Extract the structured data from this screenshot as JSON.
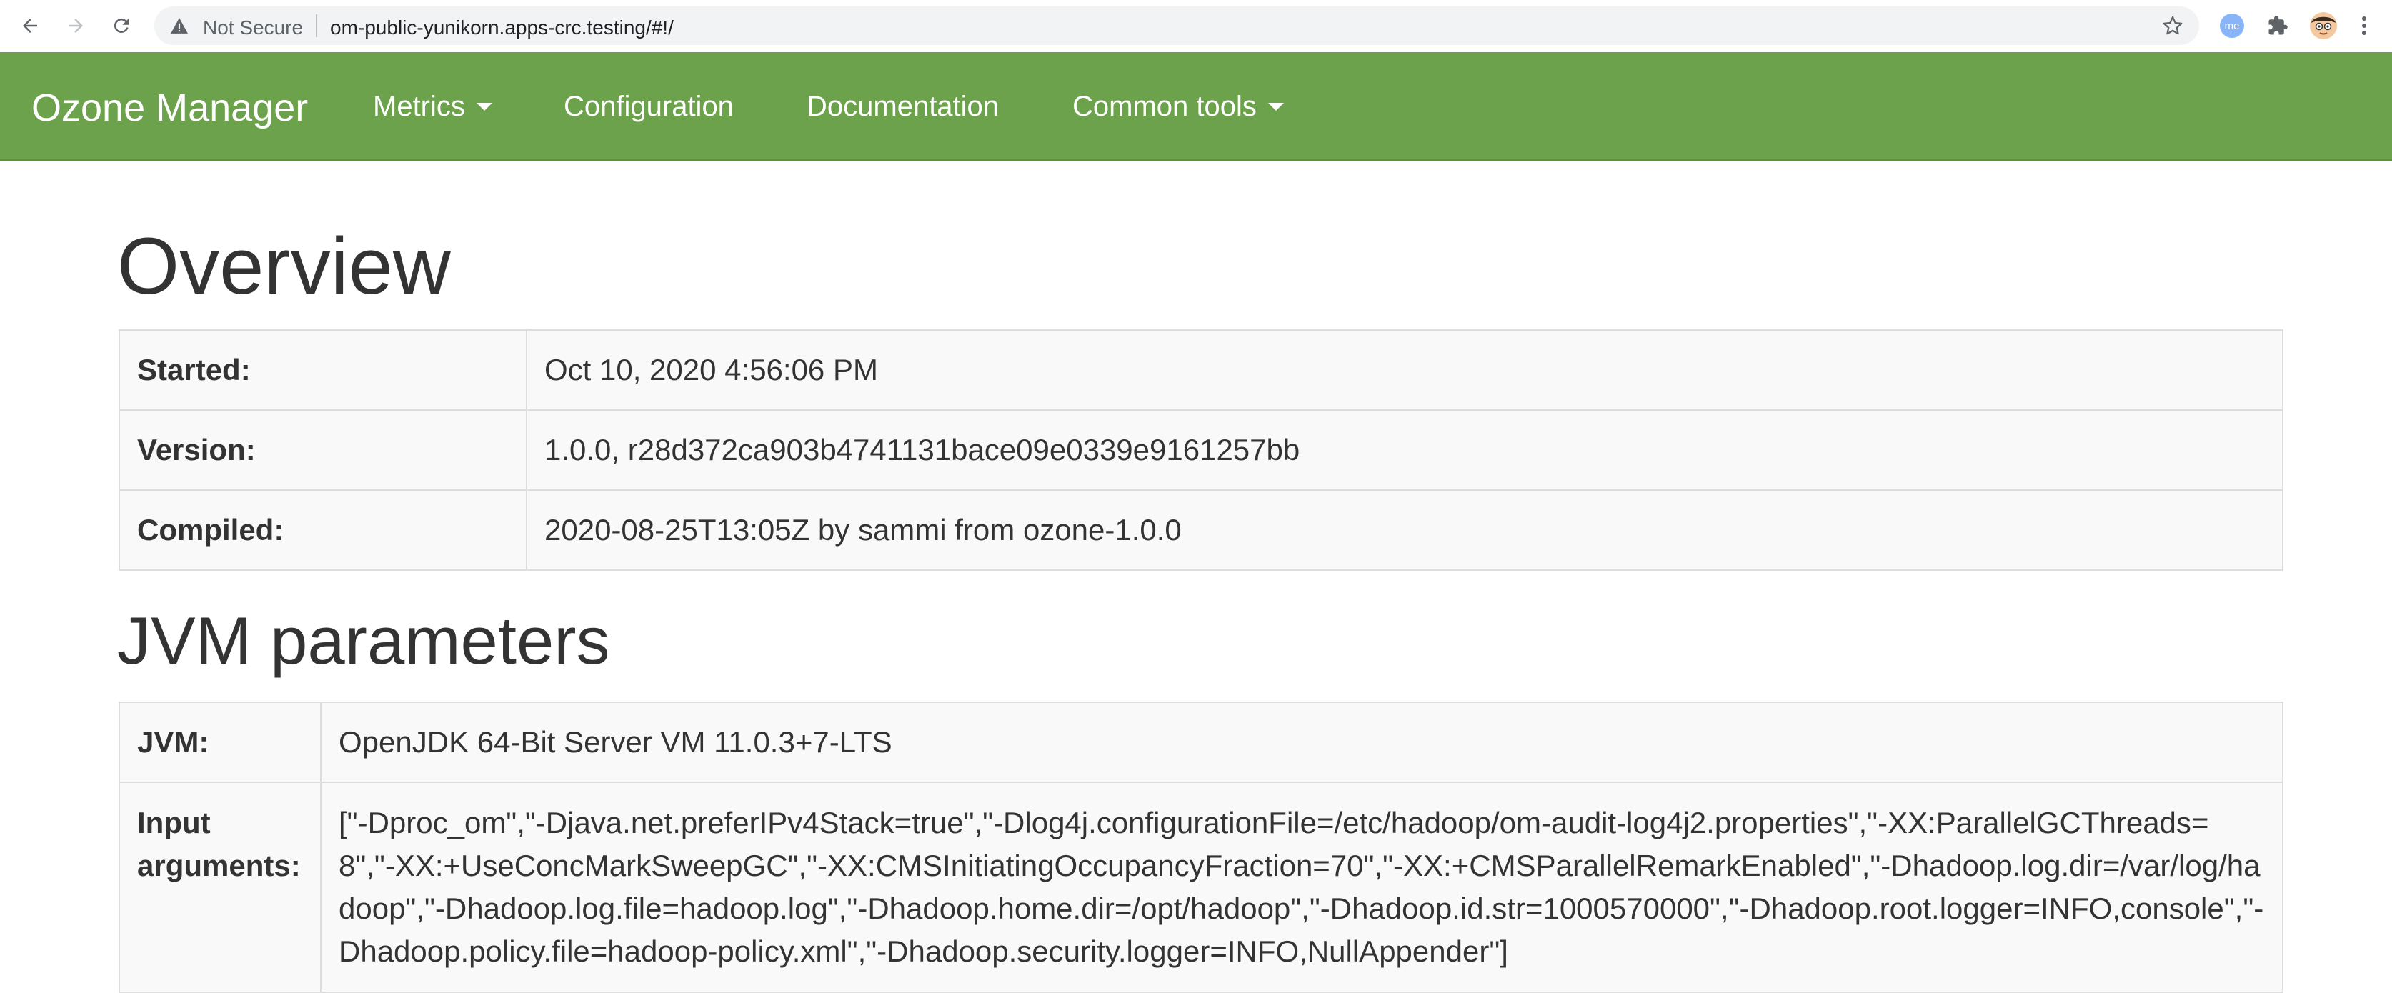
{
  "browser": {
    "security_label": "Not Secure",
    "url": "om-public-yunikorn.apps-crc.testing/#!/",
    "profile_badge": "me"
  },
  "navbar": {
    "brand": "Ozone Manager",
    "items": [
      {
        "label": "Metrics",
        "dropdown": true
      },
      {
        "label": "Configuration",
        "dropdown": false
      },
      {
        "label": "Documentation",
        "dropdown": false
      },
      {
        "label": "Common tools",
        "dropdown": true
      }
    ],
    "color": "#6da24c"
  },
  "overview": {
    "title": "Overview",
    "rows": [
      {
        "label": "Started:",
        "value": "Oct 10, 2020 4:56:06 PM"
      },
      {
        "label": "Version:",
        "value": "1.0.0, r28d372ca903b4741131bace09e0339e9161257bb"
      },
      {
        "label": "Compiled:",
        "value": "2020-08-25T13:05Z by sammi from ozone-1.0.0"
      }
    ]
  },
  "jvm": {
    "title": "JVM parameters",
    "rows": [
      {
        "label": "JVM:",
        "value": "OpenJDK 64-Bit Server VM 11.0.3+7-LTS"
      },
      {
        "label": "Input arguments:",
        "value": "[\"-Dproc_om\",\"-Djava.net.preferIPv4Stack=true\",\"-Dlog4j.configurationFile=/etc/hadoop/om-audit-log4j2.properties\",\"-XX:ParallelGCThreads=8\",\"-XX:+UseConcMarkSweepGC\",\"-XX:CMSInitiatingOccupancyFraction=70\",\"-XX:+CMSParallelRemarkEnabled\",\"-Dhadoop.log.dir=/var/log/hadoop\",\"-Dhadoop.log.file=hadoop.log\",\"-Dhadoop.home.dir=/opt/hadoop\",\"-Dhadoop.id.str=1000570000\",\"-Dhadoop.root.logger=INFO,console\",\"-Dhadoop.policy.file=hadoop-policy.xml\",\"-Dhadoop.security.logger=INFO,NullAppender\"]"
      }
    ]
  }
}
